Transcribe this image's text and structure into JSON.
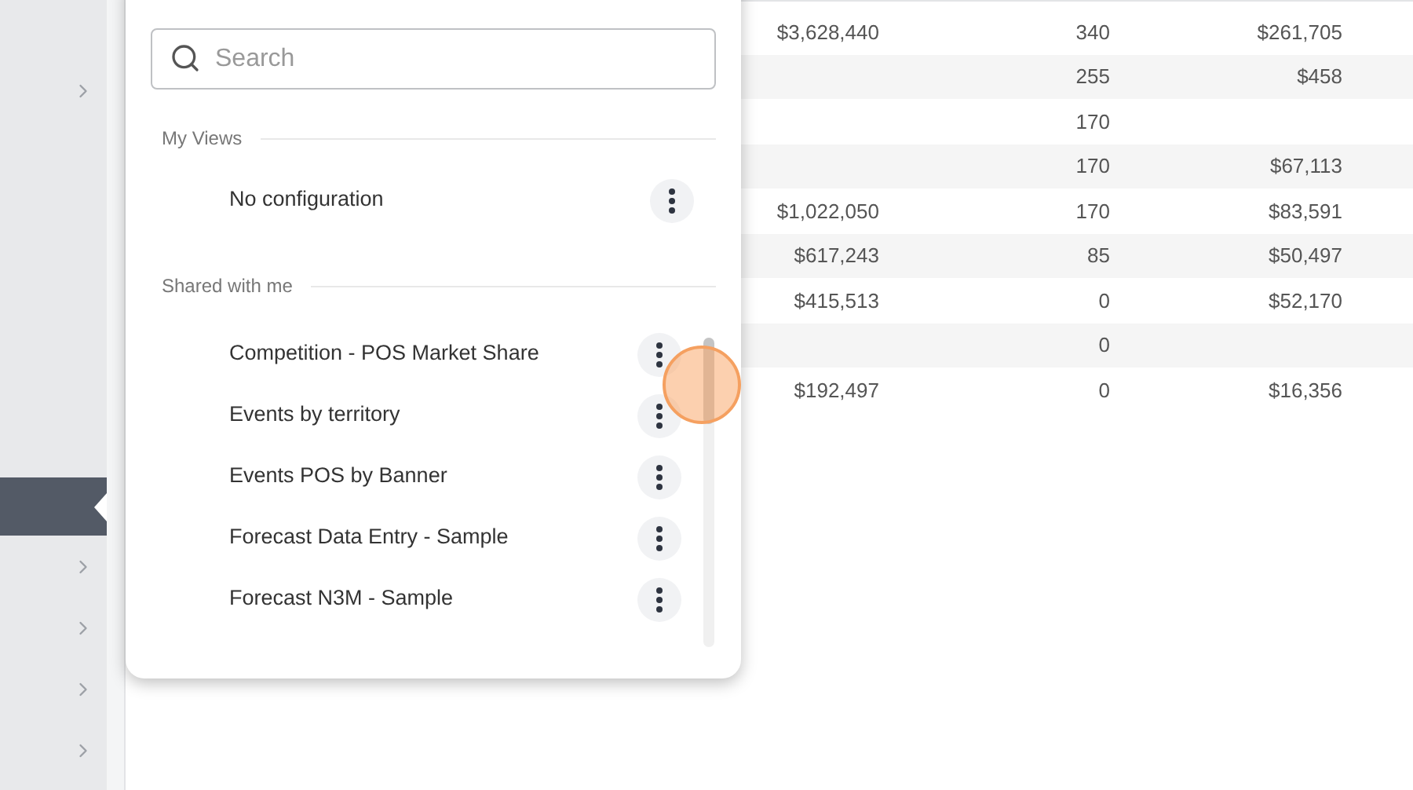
{
  "sidebar": {
    "top_items": [
      {
        "expandable": true,
        "selected": false
      }
    ],
    "bottom_items": [
      {
        "expandable": false,
        "selected": true
      },
      {
        "expandable": true,
        "selected": false
      },
      {
        "expandable": true,
        "selected": false
      },
      {
        "expandable": true,
        "selected": false
      },
      {
        "expandable": true,
        "selected": false
      }
    ]
  },
  "table": {
    "rows": [
      {
        "cells": [
          "$3,628,440",
          "340",
          "$261,705"
        ]
      },
      {
        "cells": [
          "",
          "255",
          "$458"
        ]
      },
      {
        "cells": [
          "",
          "170",
          ""
        ]
      },
      {
        "cells": [
          "",
          "170",
          "$67,113"
        ]
      },
      {
        "cells": [
          "$1,022,050",
          "170",
          "$83,591"
        ]
      },
      {
        "cells": [
          "$617,243",
          "85",
          "$50,497"
        ]
      },
      {
        "cells": [
          "$415,513",
          "0",
          "$52,170"
        ]
      },
      {
        "cells": [
          "",
          "0",
          ""
        ]
      },
      {
        "cells": [
          "$192,497",
          "0",
          "$16,356"
        ]
      }
    ]
  },
  "views_popover": {
    "search": {
      "placeholder": "Search"
    },
    "sections": [
      {
        "title": "My Views",
        "items": [
          {
            "label": "No configuration"
          }
        ]
      },
      {
        "title": "Shared with me",
        "items": [
          {
            "label": "Competition - POS Market Share"
          },
          {
            "label": "Events by territory"
          },
          {
            "label": "Events POS by Banner"
          },
          {
            "label": "Forecast Data Entry - Sample"
          },
          {
            "label": "Forecast N3M - Sample"
          }
        ]
      }
    ]
  }
}
